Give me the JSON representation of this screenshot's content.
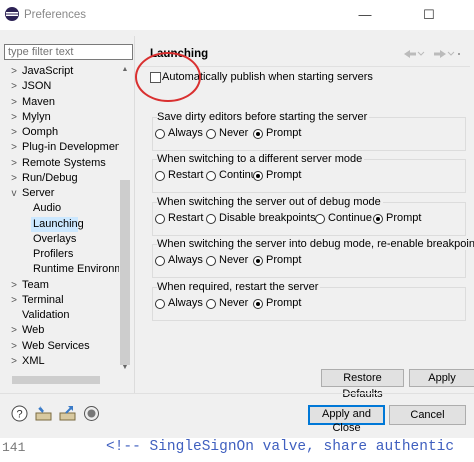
{
  "window": {
    "title": "Preferences",
    "minimize_glyph": "—",
    "maximize_glyph": "☐",
    "close_glyph": "✕"
  },
  "filter": {
    "placeholder": "type filter text"
  },
  "tree": [
    {
      "label": "JavaScript",
      "twisty": ">"
    },
    {
      "label": "JSON",
      "twisty": ">"
    },
    {
      "label": "Maven",
      "twisty": ">"
    },
    {
      "label": "Mylyn",
      "twisty": ">"
    },
    {
      "label": "Oomph",
      "twisty": ">"
    },
    {
      "label": "Plug-in Development",
      "twisty": ">"
    },
    {
      "label": "Remote Systems",
      "twisty": ">"
    },
    {
      "label": "Run/Debug",
      "twisty": ">"
    },
    {
      "label": "Server",
      "twisty": "v"
    },
    {
      "label": "Audio",
      "twisty": ""
    },
    {
      "label": "Launching",
      "twisty": "",
      "selected": true
    },
    {
      "label": "Overlays",
      "twisty": ""
    },
    {
      "label": "Profilers",
      "twisty": ""
    },
    {
      "label": "Runtime Environme",
      "twisty": ""
    },
    {
      "label": "Team",
      "twisty": ">"
    },
    {
      "label": "Terminal",
      "twisty": ">"
    },
    {
      "label": "Validation",
      "twisty": ""
    },
    {
      "label": "Web",
      "twisty": ">"
    },
    {
      "label": "Web Services",
      "twisty": ">"
    },
    {
      "label": "XML",
      "twisty": ">"
    }
  ],
  "page": {
    "title": "Launching",
    "auto_publish": {
      "label": "Automatically publish when starting servers",
      "checked": false
    }
  },
  "groups": [
    {
      "title": "Save dirty editors before starting the server",
      "options": [
        {
          "label": "Always",
          "selected": false
        },
        {
          "label": "Never",
          "selected": false
        },
        {
          "label": "Prompt",
          "selected": true
        }
      ]
    },
    {
      "title": "When switching to a different server mode",
      "options": [
        {
          "label": "Restart",
          "selected": false
        },
        {
          "label": "Continue",
          "selected": false
        },
        {
          "label": "Prompt",
          "selected": true
        }
      ]
    },
    {
      "title": "When switching the server out of debug mode",
      "options": [
        {
          "label": "Restart",
          "selected": false
        },
        {
          "label": "Disable breakpoints",
          "selected": false
        },
        {
          "label": "Continue",
          "selected": false
        },
        {
          "label": "Prompt",
          "selected": true
        }
      ]
    },
    {
      "title": "When switching the server into debug mode, re-enable breakpoints",
      "options": [
        {
          "label": "Always",
          "selected": false
        },
        {
          "label": "Never",
          "selected": false
        },
        {
          "label": "Prompt",
          "selected": true
        }
      ]
    },
    {
      "title": "When required, restart the server",
      "options": [
        {
          "label": "Always",
          "selected": false
        },
        {
          "label": "Never",
          "selected": false
        },
        {
          "label": "Prompt",
          "selected": true
        }
      ]
    }
  ],
  "buttons": {
    "restore_defaults": "Restore Defaults",
    "apply": "Apply",
    "apply_and_close": "Apply and Close",
    "cancel": "Cancel"
  },
  "footer_icons": [
    "help-icon",
    "import-icon",
    "export-icon",
    "record-icon"
  ],
  "code_line": {
    "line_number": "141",
    "text": "<!-- SingleSignOn valve, share authentic"
  },
  "accent_colors": {
    "selection": "#cce8ff",
    "annotation_circle": "#d93030",
    "default_button_border": "#0078d7",
    "code_comment": "#3f5fbf"
  }
}
